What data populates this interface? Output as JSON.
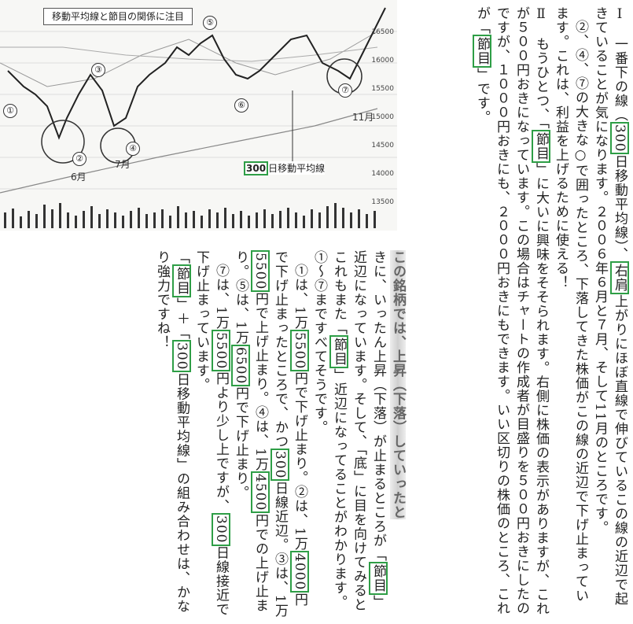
{
  "chart": {
    "title": "移動平均線と節目の関係に注目",
    "ma_num": "300",
    "ma_rest": "日移動平均線",
    "months": [
      "6月",
      "7月",
      "11月"
    ],
    "points": [
      "①",
      "②",
      "③",
      "④",
      "⑤",
      "⑥",
      "⑦"
    ],
    "prices": [
      "16500",
      "16000",
      "15500",
      "15000",
      "14500",
      "14000",
      "13500"
    ]
  },
  "right": {
    "p1": [
      "Ⅰ　一番下の線（",
      "300",
      "日移動平均線）、",
      "右肩",
      "上がりにほぼ直線で伸びているこの線の近辺で起きていることが気になります。２００６年６月と７月、そして11月のところです。"
    ],
    "p2": "②、④、⑦の大きな○で囲ったところ、下落してきた株価がこの線の近辺で下げ止まっています。これは、利益を上げるために使える！",
    "p3": [
      "Ⅱ　もうひとつ、「",
      "節目",
      "」に大いに興味をそそられます。右側に株価の表示がありますが、これが５００円おきになっています。この場合はチャートの作成者が目盛りを５００円おきにしたのですが、１０００円おきにも、２０００円おきにもできます。いい区切りの株価のところ、これが「",
      "節目",
      "」です。"
    ]
  },
  "left": {
    "intro": "この銘柄では、上昇（下落）していったと",
    "p1": [
      "きに、いったん上昇（下落）が止まるところが「",
      "節目",
      "」近辺になっています。そして、「底」に目を向けてみるとこれもまた「",
      "節目",
      "」近辺になってることがわかります。①〜⑦まですべてそうです。"
    ],
    "p2": [
      "①は、1万",
      "5500",
      "円で下げ止まり。②は、1万",
      "4000",
      "円で下げ止まったところで、かつ",
      "300",
      "日線近辺。③は、1万",
      "5500",
      "円で上げ止まり。④は、1万",
      "4500",
      "円での上げ止まり。⑤は、1万",
      "6500",
      "円で下げ止まり。"
    ],
    "p3": [
      "⑦は、1万",
      "5500",
      "円より少し上ですが、",
      "300",
      "日線接近で下げ止まっています。"
    ],
    "p4": [
      "「",
      "節目",
      "」＋「",
      "300",
      "日移動平均線」の組み合わせは、かなり強力ですね！"
    ]
  }
}
